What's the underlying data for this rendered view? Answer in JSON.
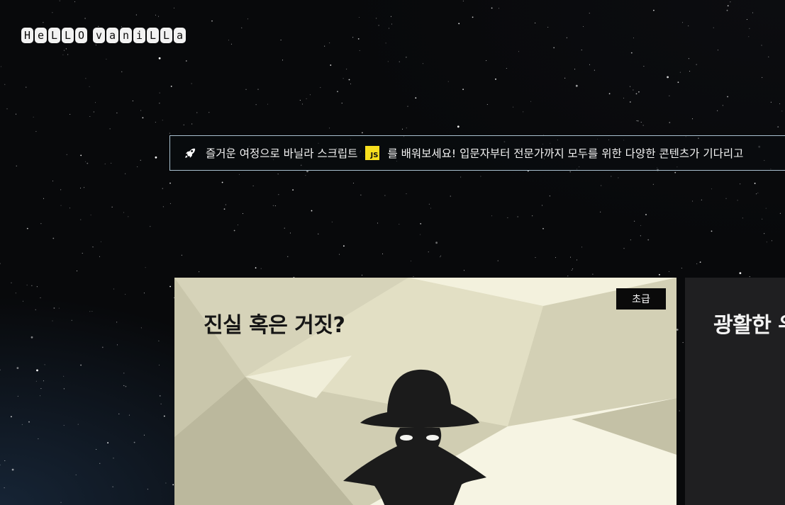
{
  "logo": {
    "chars": [
      "H",
      "e",
      "L",
      "L",
      "O",
      " ",
      "v",
      "a",
      "n",
      "i",
      "L",
      "L",
      "a"
    ]
  },
  "banner": {
    "icon": "rocket-icon",
    "text_before": "즐거운 여정으로 바닐라 스크립트",
    "badge": "JS",
    "text_after": "를 배워보세요! 입문자부터 전문가까지 모두를 위한 다양한 콘텐츠가 기다리고"
  },
  "cards": [
    {
      "title": "진실 혹은 거짓?",
      "level": "초급",
      "image": "detective-silhouette"
    },
    {
      "title": "광활한 우주"
    }
  ],
  "colors": {
    "background": "#08090b",
    "banner_border": "#a9c0cf",
    "js_badge": "#f7df1e",
    "card_light": "#e6e2c8",
    "card_dark": "#1f1f21"
  }
}
